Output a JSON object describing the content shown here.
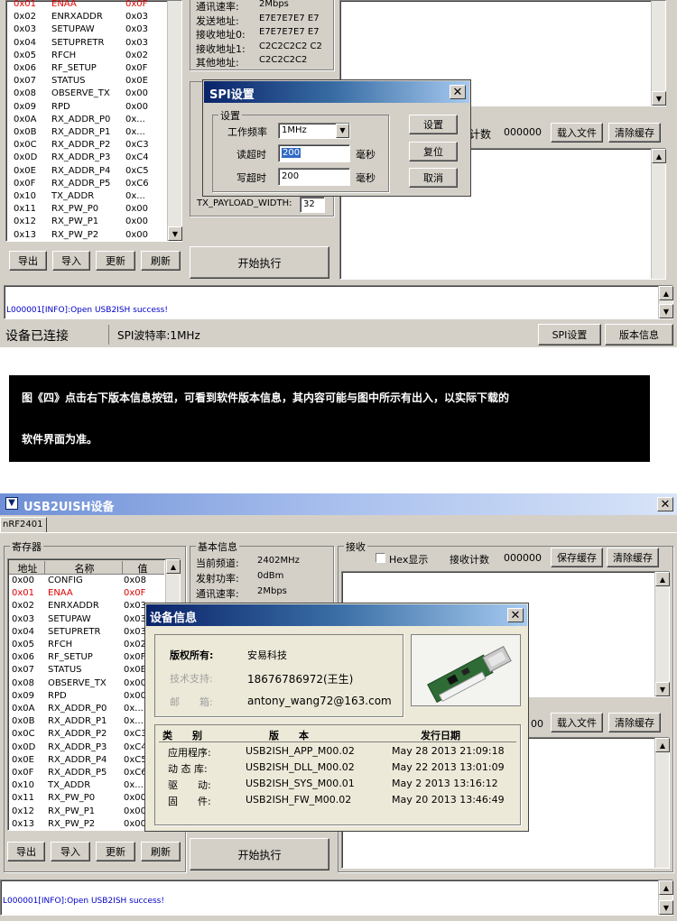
{
  "top": {
    "registers": [
      {
        "addr": "0x01",
        "name": "ENAA",
        "val": "0x0F",
        "highlight": true
      },
      {
        "addr": "0x02",
        "name": "ENRXADDR",
        "val": "0x03"
      },
      {
        "addr": "0x03",
        "name": "SETUPAW",
        "val": "0x03"
      },
      {
        "addr": "0x04",
        "name": "SETUPRETR",
        "val": "0x03"
      },
      {
        "addr": "0x05",
        "name": "RFCH",
        "val": "0x02"
      },
      {
        "addr": "0x06",
        "name": "RF_SETUP",
        "val": "0x0F"
      },
      {
        "addr": "0x07",
        "name": "STATUS",
        "val": "0x0E"
      },
      {
        "addr": "0x08",
        "name": "OBSERVE_TX",
        "val": "0x00"
      },
      {
        "addr": "0x09",
        "name": "RPD",
        "val": "0x00"
      },
      {
        "addr": "0x0A",
        "name": "RX_ADDR_P0",
        "val": "0x..."
      },
      {
        "addr": "0x0B",
        "name": "RX_ADDR_P1",
        "val": "0x..."
      },
      {
        "addr": "0x0C",
        "name": "RX_ADDR_P2",
        "val": "0xC3"
      },
      {
        "addr": "0x0D",
        "name": "RX_ADDR_P3",
        "val": "0xC4"
      },
      {
        "addr": "0x0E",
        "name": "RX_ADDR_P4",
        "val": "0xC5"
      },
      {
        "addr": "0x0F",
        "name": "RX_ADDR_P5",
        "val": "0xC6"
      },
      {
        "addr": "0x10",
        "name": "TX_ADDR",
        "val": "0x..."
      },
      {
        "addr": "0x11",
        "name": "RX_PW_P0",
        "val": "0x00"
      },
      {
        "addr": "0x12",
        "name": "RX_PW_P1",
        "val": "0x00"
      },
      {
        "addr": "0x13",
        "name": "RX_PW_P2",
        "val": "0x00"
      }
    ],
    "info_lines": [
      {
        "label": "通讯速率:",
        "value": "2Mbps"
      },
      {
        "label": "发送地址:",
        "value": "E7E7E7E7 E7"
      },
      {
        "label": "接收地址0:",
        "value": "E7E7E7E7 E7"
      },
      {
        "label": "接收地址1:",
        "value": "C2C2C2C2 C2"
      },
      {
        "label": "其他地址:",
        "value": "C2C2C2C2"
      }
    ],
    "buttons": {
      "export": "导出",
      "import": "导入",
      "refresh": "更新",
      "flush": "刷新",
      "start": "开始执行",
      "load_file": "载入文件",
      "clear_cache": "清除缓存",
      "spi_settings": "SPI设置",
      "version_info": "版本信息"
    },
    "recv_count_label": "计数",
    "recv_count": "000000",
    "tx_payload_label": "TX_PAYLOAD_WIDTH:",
    "tx_payload_value": "32",
    "log_text": "L000001[INFO]:Open USB2ISH success!",
    "status_connected": "设备已连接",
    "status_spi_rate": "SPI波特率:1MHz",
    "spi_dialog": {
      "title": "SPI设置",
      "group": "设置",
      "freq_label": "工作频率",
      "freq_value": "1MHz",
      "read_timeout_label": "读超时",
      "read_timeout_value": "200",
      "write_timeout_label": "写超时",
      "write_timeout_value": "200",
      "unit": "毫秒",
      "set_btn": "设置",
      "reset_btn": "复位",
      "cancel_btn": "取消"
    }
  },
  "caption": {
    "line1": "图《四》点击右下版本信息按钮，可看到软件版本信息，其内容可能与图中所示有出入，以实际下载的",
    "line2": "软件界面为准。"
  },
  "bottom": {
    "window_title": "USB2UISH设备",
    "tab": "nRF2401",
    "registers_title": "寄存器",
    "col_headers": {
      "addr": "地址",
      "name": "名称",
      "val": "值"
    },
    "registers": [
      {
        "addr": "0x00",
        "name": "CONFIG",
        "val": "0x08"
      },
      {
        "addr": "0x01",
        "name": "ENAA",
        "val": "0x0F",
        "highlight": true
      },
      {
        "addr": "0x02",
        "name": "ENRXADDR",
        "val": "0x03"
      },
      {
        "addr": "0x03",
        "name": "SETUPAW",
        "val": "0x03"
      },
      {
        "addr": "0x04",
        "name": "SETUPRETR",
        "val": "0x03"
      },
      {
        "addr": "0x05",
        "name": "RFCH",
        "val": "0x02"
      },
      {
        "addr": "0x06",
        "name": "RF_SETUP",
        "val": "0x0F"
      },
      {
        "addr": "0x07",
        "name": "STATUS",
        "val": "0x0E"
      },
      {
        "addr": "0x08",
        "name": "OBSERVE_TX",
        "val": "0x00"
      },
      {
        "addr": "0x09",
        "name": "RPD",
        "val": "0x00"
      },
      {
        "addr": "0x0A",
        "name": "RX_ADDR_P0",
        "val": "0x..."
      },
      {
        "addr": "0x0B",
        "name": "RX_ADDR_P1",
        "val": "0x..."
      },
      {
        "addr": "0x0C",
        "name": "RX_ADDR_P2",
        "val": "0xC3"
      },
      {
        "addr": "0x0D",
        "name": "RX_ADDR_P3",
        "val": "0xC4"
      },
      {
        "addr": "0x0E",
        "name": "RX_ADDR_P4",
        "val": "0xC5"
      },
      {
        "addr": "0x0F",
        "name": "RX_ADDR_P5",
        "val": "0xC6"
      },
      {
        "addr": "0x10",
        "name": "TX_ADDR",
        "val": "0x..."
      },
      {
        "addr": "0x11",
        "name": "RX_PW_P0",
        "val": "0x00"
      },
      {
        "addr": "0x12",
        "name": "RX_PW_P1",
        "val": "0x00"
      },
      {
        "addr": "0x13",
        "name": "RX_PW_P2",
        "val": "0x00"
      }
    ],
    "basic_info_title": "基本信息",
    "info_lines": [
      {
        "label": "当前频道:",
        "value": "2402MHz"
      },
      {
        "label": "发射功率:",
        "value": "0dBm"
      },
      {
        "label": "通讯速率:",
        "value": "2Mbps"
      }
    ],
    "recv_title": "接收",
    "hex_display": "Hex显示",
    "recv_count_label": "接收计数",
    "recv_count": "000000",
    "buttons": {
      "save_cache": "保存缓存",
      "clear_cache": "清除缓存",
      "load_file": "载入文件",
      "clear_cache2": "清除缓存",
      "export": "导出",
      "import": "导入",
      "refresh": "更新",
      "flush": "刷新",
      "start": "开始执行"
    },
    "recv_count2": "00",
    "log_text": "L000001[INFO]:Open USB2ISH success!",
    "device_dialog": {
      "title": "设备信息",
      "copyright_label": "版权所有:",
      "copyright_value": "安易科技",
      "support_label": "技术支持:",
      "support_value": "18676786972(王生)",
      "email_label": "邮　　箱:",
      "email_value": "antony_wang72@163.com",
      "headers": {
        "type": "类　　别",
        "version": "版　　本",
        "date": "发行日期"
      },
      "rows": [
        {
          "type": "应用程序:",
          "version": "USB2ISH_APP_M00.02",
          "date": "May 28 2013 21:09:18"
        },
        {
          "type": "动 态 库:",
          "version": "USB2ISH_DLL_M00.02",
          "date": "May 22 2013 13:01:09"
        },
        {
          "type": "驱　　动:",
          "version": "USB2ISH_SYS_M00.01",
          "date": "May  2 2013 13:16:12"
        },
        {
          "type": "固　　件:",
          "version": "USB2ISH_FW_M00.02",
          "date": "May 20 2013 13:46:49"
        }
      ]
    }
  }
}
